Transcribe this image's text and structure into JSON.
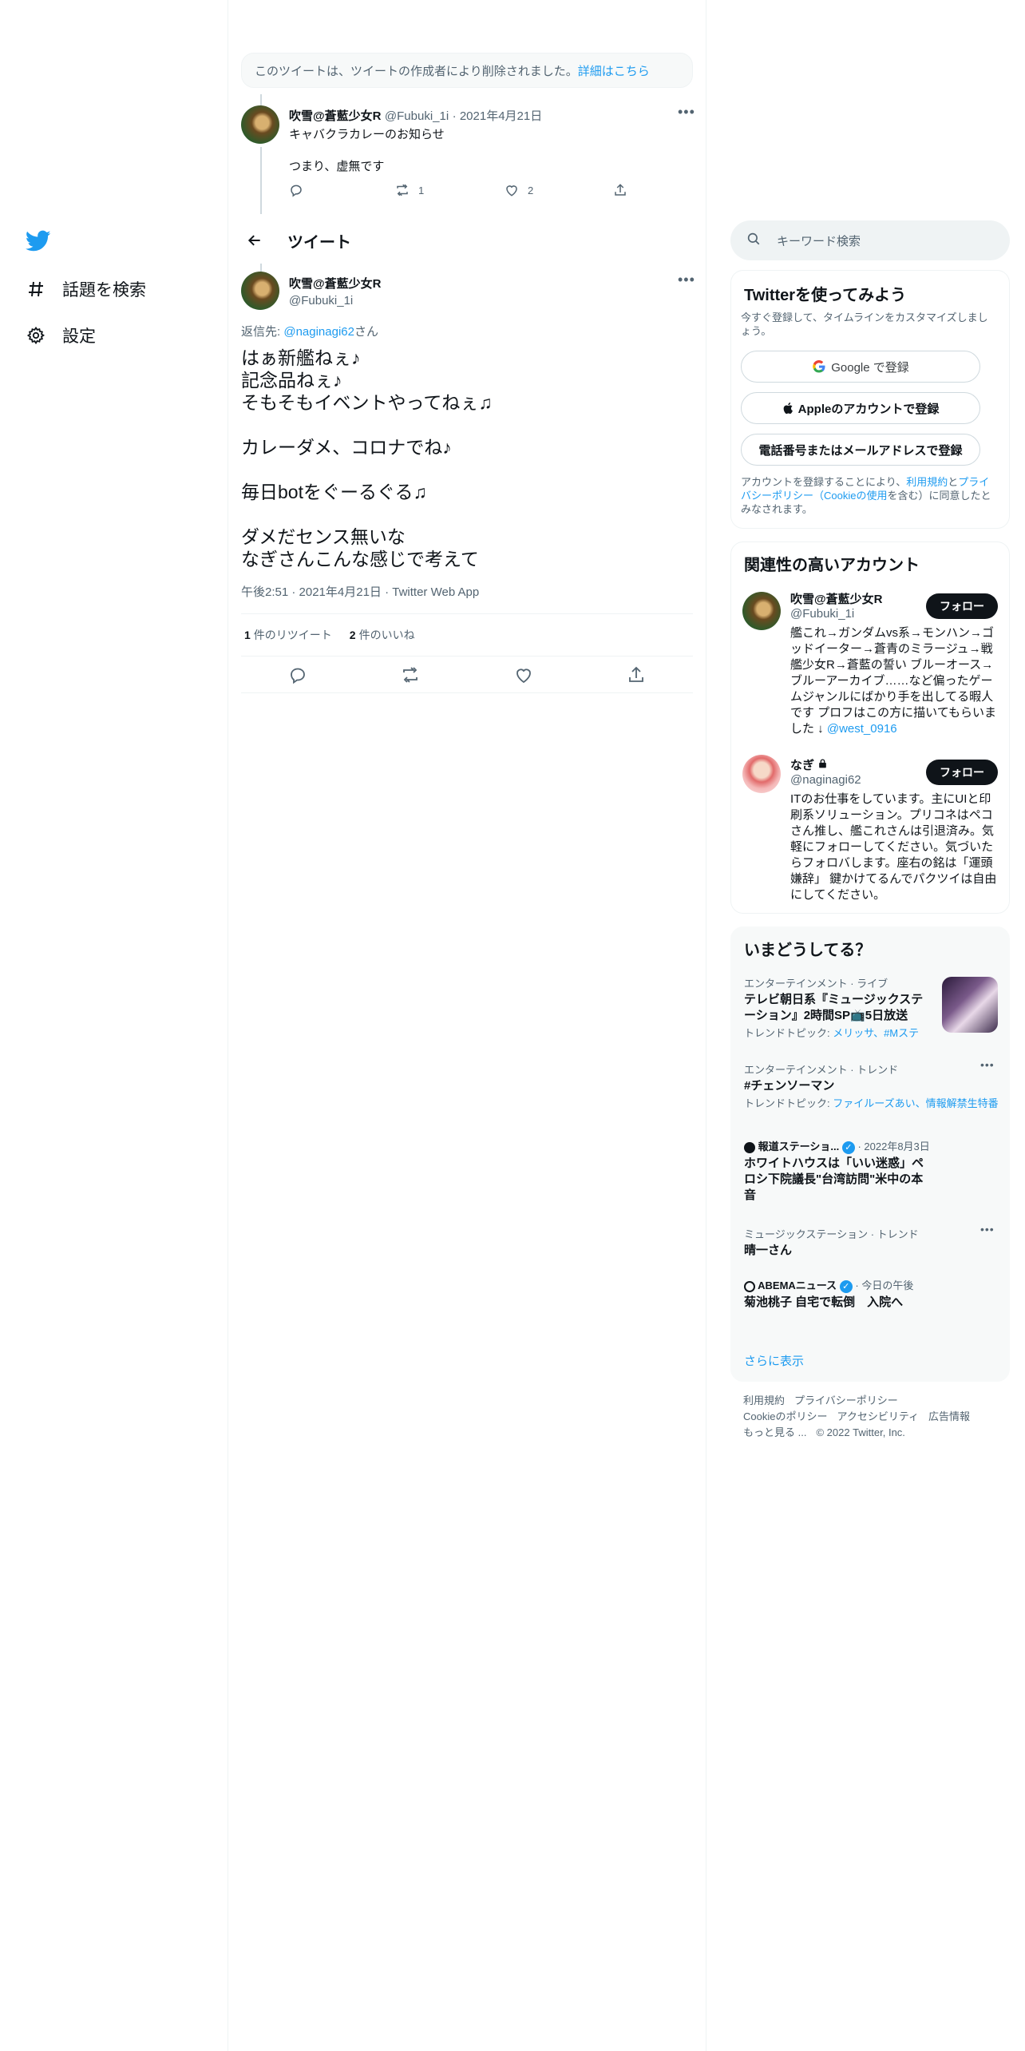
{
  "nav": {
    "logo": "twitter-bird-icon",
    "items": [
      {
        "label": "話題を検索",
        "icon": "hash-icon"
      },
      {
        "label": "設定",
        "icon": "gear-icon"
      }
    ]
  },
  "deleted_notice": {
    "text": "このツイートは、ツイートの作成者により削除されました。",
    "link": "詳細はこちら"
  },
  "parent_tweet": {
    "name": "吹雪@蒼藍少女R",
    "handle": "@Fubuki_1i",
    "date": "· 2021年4月21日",
    "line1": "キャバクラカレーのお知らせ",
    "line2": "つまり、虚無です",
    "retweets": "1",
    "likes": "2"
  },
  "header": {
    "title": "ツイート"
  },
  "main_tweet": {
    "name": "吹雪@蒼藍少女R",
    "handle": "@Fubuki_1i",
    "reply_prefix": "返信先: ",
    "reply_to": "@naginagi62",
    "reply_suffix": "さん",
    "text": "はぁ新艦ねぇ♪\n記念品ねぇ♪\nそもそもイベントやってねぇ♫\n\nカレーダメ、コロナでね♪\n\n毎日botをぐーるぐる♫\n\nダメだセンス無いな\nなぎさんこんな感じで考えて",
    "timestamp": "午後2:51 · 2021年4月21日 · Twitter Web App",
    "retweet_count": "1",
    "retweet_label": "件のリツイート",
    "like_count": "2",
    "like_label": "件のいいね"
  },
  "search": {
    "placeholder": "キーワード検索"
  },
  "signup": {
    "title": "Twitterを使ってみよう",
    "subtitle": "今すぐ登録して、タイムラインをカスタマイズしましょう。",
    "google": "Google で登録",
    "apple": "Appleのアカウントで登録",
    "phone": "電話番号またはメールアドレスで登録",
    "legal_pre": "アカウントを登録することにより、",
    "legal_terms": "利用規約",
    "legal_and": "と",
    "legal_privacy": "プライバシーポリシー（Cookieの使用",
    "legal_post": "を含む）に同意したとみなされます。"
  },
  "related": {
    "title": "関連性の高いアカウント",
    "accounts": [
      {
        "name": "吹雪@蒼藍少女R",
        "handle": "@Fubuki_1i",
        "follow": "フォロー",
        "bio": "艦これ→ガンダムvs系→モンハン→ゴッドイーター→蒼青のミラージュ→戦艦少女R→蒼藍の誓い ブルーオース→ブルーアーカイブ……など偏ったゲームジャンルにばかり手を出してる暇人です プロフはこの方に描いてもらいました ↓ ",
        "bio_link": "@west_0916"
      },
      {
        "name": "なぎ",
        "handle": "@naginagi62",
        "follow": "フォロー",
        "bio": "ITのお仕事をしています。主にUIと印刷系ソリューション。プリコネはペコさん推し、艦これさんは引退済み。気軽にフォローしてください。気づいたらフォロバします。座右の銘は「運頭嫌辞」 鍵かけてるんでパクツイは自由にしてください。",
        "bio_link": ""
      }
    ]
  },
  "trends": {
    "title": "いまどうしてる？",
    "items": [
      {
        "category": "エンターテインメント · ライブ",
        "title": "テレビ朝日系『ミュージックステーション』2時間SP📺5日放送",
        "topic_label": "トレンドトピック: ",
        "topics": "メリッサ、#Mステ"
      },
      {
        "category": "エンターテインメント · トレンド",
        "title": "#チェンソーマン",
        "topic_label": "トレンドトピック: ",
        "topics": "ファイルーズあい、情報解禁生特番"
      },
      {
        "category": "報道ステーショ...",
        "date": "· 2022年8月3日",
        "title": "ホワイトハウスは「いい迷惑」ペロシ下院議長\"台湾訪問\"米中の本音"
      },
      {
        "category": "ミュージックステーション · トレンド",
        "title": "晴一さん"
      },
      {
        "category": "ABEMAニュース",
        "date": "· 今日の午後",
        "title": "菊池桃子 自宅で転倒　入院へ"
      }
    ],
    "show_more": "さらに表示"
  },
  "footer": {
    "links": [
      "利用規約",
      "プライバシーポリシー",
      "Cookieのポリシー",
      "アクセシビリティ",
      "広告情報",
      "もっと見る ..."
    ],
    "copyright": "© 2022 Twitter, Inc."
  }
}
